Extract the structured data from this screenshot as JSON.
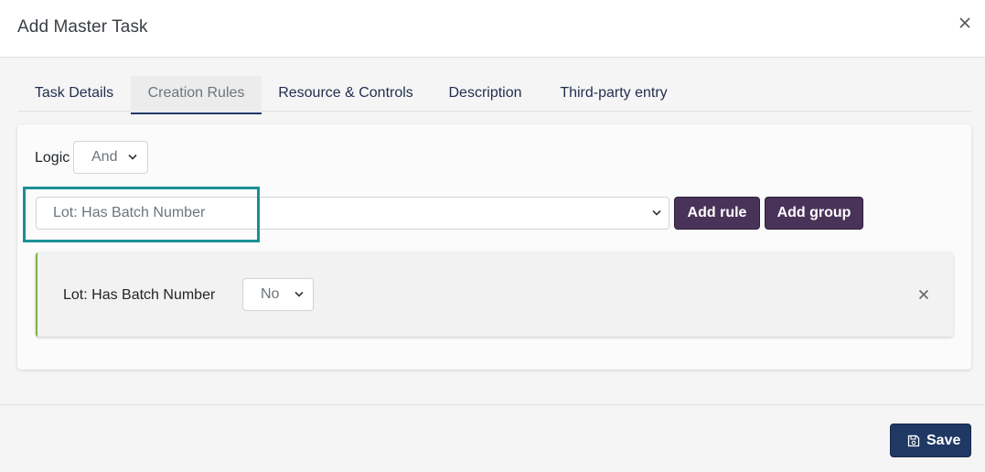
{
  "modal": {
    "title": "Add Master Task"
  },
  "tabs": [
    {
      "label": "Task Details",
      "active": false
    },
    {
      "label": "Creation Rules",
      "active": true
    },
    {
      "label": "Resource & Controls",
      "active": false
    },
    {
      "label": "Description",
      "active": false
    },
    {
      "label": "Third-party entry",
      "active": false
    }
  ],
  "rules": {
    "logic_label": "Logic",
    "logic_value": "And",
    "rule_select_value": "Lot: Has Batch Number",
    "add_rule_label": "Add rule",
    "add_group_label": "Add group",
    "rows": [
      {
        "label": "Lot: Has Batch Number",
        "value": "No"
      }
    ]
  },
  "footer": {
    "save_label": "Save"
  },
  "colors": {
    "primary": "#1f3864",
    "button_purple": "#4a3358",
    "highlight": "#1c8e97",
    "rule_accent": "#7cb342"
  },
  "icons": {
    "close": "close-icon",
    "chevron": "chevron-down-icon",
    "save": "save-icon",
    "remove": "remove-rule-icon"
  }
}
